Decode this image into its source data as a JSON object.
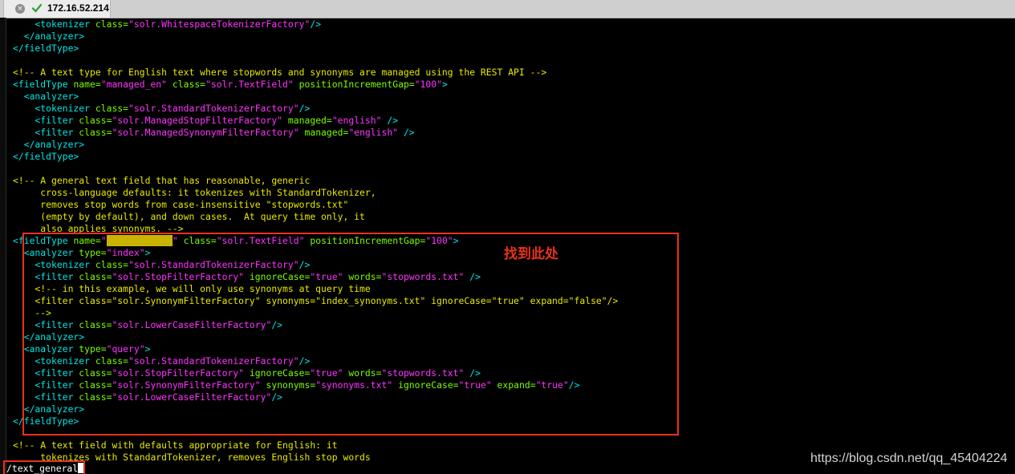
{
  "tab": {
    "title": "172.16.52.214",
    "close_glyph": "×",
    "status_icon": "check-icon"
  },
  "colors": {
    "tag": "#00e6e6",
    "attr": "#7cfc00",
    "value": "#ff33ff",
    "comment": "#e8e800",
    "highlight": "#c8b400",
    "annotation": "#e8321b"
  },
  "lines": [
    [
      [
        "t",
        "    <tokenizer "
      ],
      [
        "a",
        "class="
      ],
      [
        "v",
        "\"solr.WhitespaceTokenizerFactory\""
      ],
      [
        "t",
        "/>"
      ]
    ],
    [
      [
        "t",
        "  </analyzer>"
      ]
    ],
    [
      [
        "t",
        "</fieldType>"
      ]
    ],
    [],
    [
      [
        "c",
        "<!-- A text type for English text where stopwords and synonyms are managed using the REST API -->"
      ]
    ],
    [
      [
        "t",
        "<fieldType "
      ],
      [
        "a",
        "name="
      ],
      [
        "v",
        "\"managed_en\""
      ],
      [
        "t",
        " "
      ],
      [
        "a",
        "class="
      ],
      [
        "v",
        "\"solr.TextField\""
      ],
      [
        "t",
        " "
      ],
      [
        "a",
        "positionIncrementGap="
      ],
      [
        "v",
        "\"100\""
      ],
      [
        "t",
        ">"
      ]
    ],
    [
      [
        "t",
        "  <analyzer>"
      ]
    ],
    [
      [
        "t",
        "    <tokenizer "
      ],
      [
        "a",
        "class="
      ],
      [
        "v",
        "\"solr.StandardTokenizerFactory\""
      ],
      [
        "t",
        "/>"
      ]
    ],
    [
      [
        "t",
        "    <filter "
      ],
      [
        "a",
        "class="
      ],
      [
        "v",
        "\"solr.ManagedStopFilterFactory\""
      ],
      [
        "t",
        " "
      ],
      [
        "a",
        "managed="
      ],
      [
        "v",
        "\"english\""
      ],
      [
        "t",
        " />"
      ]
    ],
    [
      [
        "t",
        "    <filter "
      ],
      [
        "a",
        "class="
      ],
      [
        "v",
        "\"solr.ManagedSynonymFilterFactory\""
      ],
      [
        "t",
        " "
      ],
      [
        "a",
        "managed="
      ],
      [
        "v",
        "\"english\""
      ],
      [
        "t",
        " />"
      ]
    ],
    [
      [
        "t",
        "  </analyzer>"
      ]
    ],
    [
      [
        "t",
        "</fieldType>"
      ]
    ],
    [],
    [
      [
        "c",
        "<!-- A general text field that has reasonable, generic"
      ]
    ],
    [
      [
        "c",
        "     cross-language defaults: it tokenizes with StandardTokenizer,"
      ]
    ],
    [
      [
        "c",
        "     removes stop words from case-insensitive \"stopwords.txt\""
      ]
    ],
    [
      [
        "c",
        "     (empty by default), and down cases.  At query time only, it"
      ]
    ],
    [
      [
        "c",
        "     also applies synonyms. -->"
      ]
    ],
    [
      [
        "t",
        "<fieldType "
      ],
      [
        "a",
        "name="
      ],
      [
        "v",
        "\""
      ],
      [
        "hl",
        "text_general"
      ],
      [
        "v",
        "\""
      ],
      [
        "t",
        " "
      ],
      [
        "a",
        "class="
      ],
      [
        "v",
        "\"solr.TextField\""
      ],
      [
        "t",
        " "
      ],
      [
        "a",
        "positionIncrementGap="
      ],
      [
        "v",
        "\"100\""
      ],
      [
        "t",
        ">"
      ]
    ],
    [
      [
        "t",
        "  <analyzer "
      ],
      [
        "a",
        "type="
      ],
      [
        "v",
        "\"index\""
      ],
      [
        "t",
        ">"
      ]
    ],
    [
      [
        "t",
        "    <tokenizer "
      ],
      [
        "a",
        "class="
      ],
      [
        "v",
        "\"solr.StandardTokenizerFactory\""
      ],
      [
        "t",
        "/>"
      ]
    ],
    [
      [
        "t",
        "    <filter "
      ],
      [
        "a",
        "class="
      ],
      [
        "v",
        "\"solr.StopFilterFactory\""
      ],
      [
        "t",
        " "
      ],
      [
        "a",
        "ignoreCase="
      ],
      [
        "v",
        "\"true\""
      ],
      [
        "t",
        " "
      ],
      [
        "a",
        "words="
      ],
      [
        "v",
        "\"stopwords.txt\""
      ],
      [
        "t",
        " />"
      ]
    ],
    [
      [
        "c",
        "    <!-- in this example, we will only use synonyms at query time"
      ]
    ],
    [
      [
        "c",
        "    <filter class=\"solr.SynonymFilterFactory\" synonyms=\"index_synonyms.txt\" ignoreCase=\"true\" expand=\"false\"/>"
      ]
    ],
    [
      [
        "c",
        "    -->"
      ]
    ],
    [
      [
        "t",
        "    <filter "
      ],
      [
        "a",
        "class="
      ],
      [
        "v",
        "\"solr.LowerCaseFilterFactory\""
      ],
      [
        "t",
        "/>"
      ]
    ],
    [
      [
        "t",
        "  </analyzer>"
      ]
    ],
    [
      [
        "t",
        "  <analyzer "
      ],
      [
        "a",
        "type="
      ],
      [
        "v",
        "\"query\""
      ],
      [
        "t",
        ">"
      ]
    ],
    [
      [
        "t",
        "    <tokenizer "
      ],
      [
        "a",
        "class="
      ],
      [
        "v",
        "\"solr.StandardTokenizerFactory\""
      ],
      [
        "t",
        "/>"
      ]
    ],
    [
      [
        "t",
        "    <filter "
      ],
      [
        "a",
        "class="
      ],
      [
        "v",
        "\"solr.StopFilterFactory\""
      ],
      [
        "t",
        " "
      ],
      [
        "a",
        "ignoreCase="
      ],
      [
        "v",
        "\"true\""
      ],
      [
        "t",
        " "
      ],
      [
        "a",
        "words="
      ],
      [
        "v",
        "\"stopwords.txt\""
      ],
      [
        "t",
        " />"
      ]
    ],
    [
      [
        "t",
        "    <filter "
      ],
      [
        "a",
        "class="
      ],
      [
        "v",
        "\"solr.SynonymFilterFactory\""
      ],
      [
        "t",
        " "
      ],
      [
        "a",
        "synonyms="
      ],
      [
        "v",
        "\"synonyms.txt\""
      ],
      [
        "t",
        " "
      ],
      [
        "a",
        "ignoreCase="
      ],
      [
        "v",
        "\"true\""
      ],
      [
        "t",
        " "
      ],
      [
        "a",
        "expand="
      ],
      [
        "v",
        "\"true\""
      ],
      [
        "t",
        "/>"
      ]
    ],
    [
      [
        "t",
        "    <filter "
      ],
      [
        "a",
        "class="
      ],
      [
        "v",
        "\"solr.LowerCaseFilterFactory\""
      ],
      [
        "t",
        "/>"
      ]
    ],
    [
      [
        "t",
        "  </analyzer>"
      ]
    ],
    [
      [
        "t",
        "</fieldType>"
      ]
    ],
    [],
    [
      [
        "c",
        "<!-- A text field with defaults appropriate for English: it"
      ]
    ],
    [
      [
        "c",
        "     tokenizes with StandardTokenizer, removes English stop words"
      ]
    ]
  ],
  "annotation": "找到此处",
  "search_command": "/text_general",
  "watermark": "https://blog.csdn.net/qq_45404224"
}
